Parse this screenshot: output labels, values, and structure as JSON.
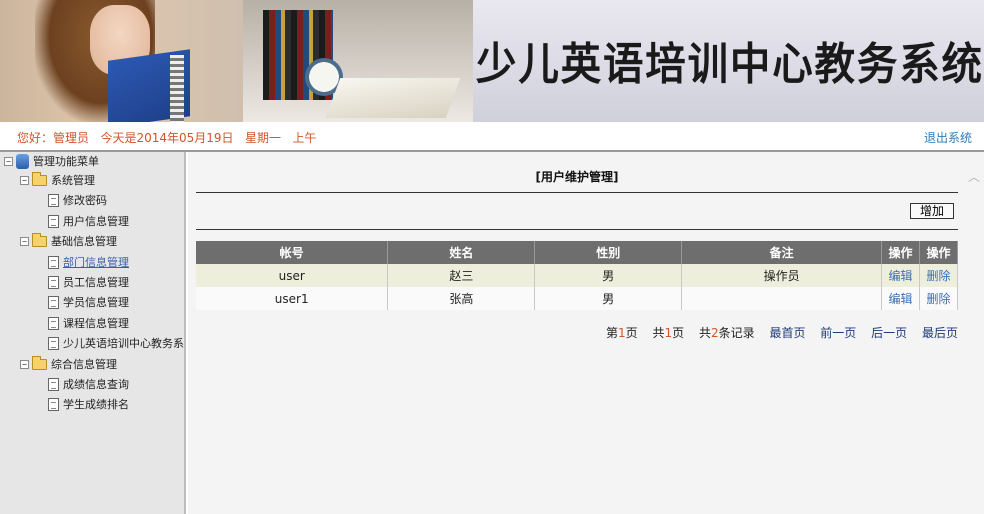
{
  "banner": {
    "system_title": "少儿英语培训中心教务系统"
  },
  "infobar": {
    "greeting": "您好：管理员   今天是2014年05月19日   星期一   上午",
    "logout_label": "退出系统"
  },
  "sidebar": {
    "root_label": "管理功能菜单",
    "groups": [
      {
        "label": "系统管理",
        "items": [
          "修改密码",
          "用户信息管理"
        ]
      },
      {
        "label": "基础信息管理",
        "items": [
          "部门信息管理",
          "员工信息管理",
          "学员信息管理",
          "课程信息管理",
          "少儿英语培训中心教务系"
        ]
      },
      {
        "label": "综合信息管理",
        "items": [
          "成绩信息查询",
          "学生成绩排名"
        ]
      }
    ]
  },
  "main": {
    "heading": "[用户维护管理]",
    "add_label": "增加",
    "columns": [
      "帐号",
      "姓名",
      "性别",
      "备注",
      "操作",
      "操作"
    ],
    "rows": [
      {
        "account": "user",
        "name": "赵三",
        "gender": "男",
        "remark": "操作员",
        "edit": "编辑",
        "delete": "删除"
      },
      {
        "account": "user1",
        "name": "张高",
        "gender": "男",
        "remark": "",
        "edit": "编辑",
        "delete": "删除"
      }
    ],
    "pager": {
      "page_prefix": "第",
      "page_current": "1",
      "page_suffix": "页",
      "total_prefix": "共",
      "total_pages": "1",
      "total_suffix": "页",
      "records_prefix": "共",
      "records_count": "2",
      "records_suffix": "条记录",
      "first": "最首页",
      "prev": "前一页",
      "next": "后一页",
      "last": "最后页"
    }
  },
  "colors": {
    "greeting": "#d0552a",
    "link": "#2e7bb5",
    "table_header": "#6e6e6e",
    "row_highlight": "#eeeedc"
  }
}
